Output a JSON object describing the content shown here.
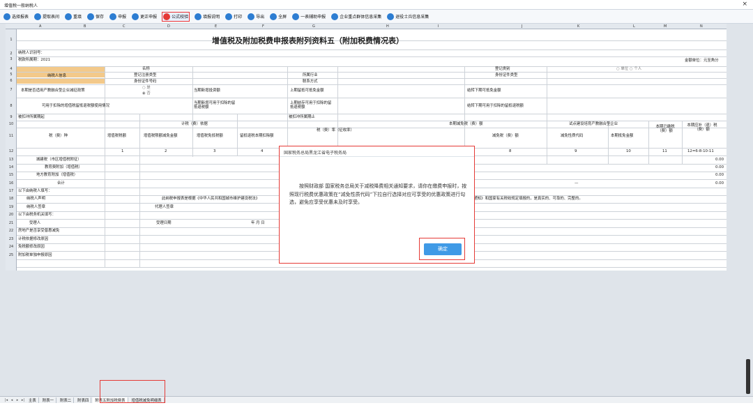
{
  "window": {
    "title": "增值税一般纳税人",
    "close": "×"
  },
  "toolbar": [
    {
      "icon": "list-icon",
      "label": "选择报表",
      "color": "#2d7dd2"
    },
    {
      "icon": "share-icon",
      "label": "提取表间",
      "color": "#2d7dd2"
    },
    {
      "icon": "close-circle-icon",
      "label": "重填",
      "color": "#2d7dd2"
    },
    {
      "icon": "save-icon",
      "label": "保存",
      "color": "#2d7dd2"
    },
    {
      "icon": "cloud-upload-icon",
      "label": "申报",
      "color": "#2d7dd2"
    },
    {
      "icon": "cloud-refresh-icon",
      "label": "更正申报",
      "color": "#2d7dd2"
    },
    {
      "icon": "formula-icon",
      "label": "公式校验",
      "color": "#e53935"
    },
    {
      "icon": "help-icon",
      "label": "填报说明",
      "color": "#2d7dd2"
    },
    {
      "icon": "print-icon",
      "label": "打印",
      "color": "#2d7dd2"
    },
    {
      "icon": "export-icon",
      "label": "导出",
      "color": "#2d7dd2"
    },
    {
      "icon": "fullscreen-icon",
      "label": "全屏",
      "color": "#2d7dd2"
    },
    {
      "icon": "resize-icon",
      "label": "一表辅助申报",
      "color": "#2d7dd2"
    },
    {
      "icon": "cloud-collect-icon",
      "label": "企业重点群体信息采集",
      "color": "#2d7dd2"
    },
    {
      "icon": "cloud-collect-icon",
      "label": "退役士兵信息采集",
      "color": "#2d7dd2"
    }
  ],
  "columns": [
    "A",
    "B",
    "C",
    "D",
    "E",
    "F",
    "G",
    "H",
    "I",
    "J",
    "K",
    "L",
    "M",
    "N"
  ],
  "rownums": [
    "1",
    "2",
    "3",
    "4",
    "5",
    "6",
    "7",
    "8",
    "9",
    "10",
    "11",
    "12",
    "13",
    "14",
    "15",
    "16",
    "17",
    "18",
    "19",
    "20",
    "21",
    "22",
    "23",
    "24",
    "25"
  ],
  "sheet": {
    "title": "增值税及附加税费申报表附列资料五（附加税费情况表）",
    "taxpayer_id": "纳税人识别号：",
    "period": "税款所属期：2021",
    "unit": "金额单位：元至角分",
    "r4_name": "名称",
    "r4_regtype": "登记类别",
    "r4_radio": "○ 单位 ○ 个人",
    "r5_info": "纳税人信息",
    "r5_reg": "登记注册类型",
    "r5_industry": "所属行业",
    "r5_idtype": "身份证件类型",
    "r6_idno": "身份证件号码",
    "r6_contact": "联系方式",
    "r7_q": "本期是否适用产教融合型企业减征政策",
    "r7_yes": "○ 是",
    "r7_no": "◉ 否",
    "r7_invest": "当期新增投资额",
    "r7_lastcredit": "上期留抵可抵免金额",
    "r7_nextcredit": "结转下期可抵免金额",
    "r8_usage": "可用于扣除的增值税留抵退税额使用情况",
    "r8_newcredit": "当期新增可用于扣除的留抵退税额",
    "r8_lastremain": "上期结存可用于扣除的留抵退税额",
    "r8_nextremain": "结转下期可用于扣除的留抵退税额",
    "r9_start": "被扣冲所属期起",
    "r9_end": "被扣冲所属期止",
    "r10_basis": "计税（费）依据",
    "r10_reduce": "本期减免税（费）额",
    "r10_pilot": "试点建设培育产教融合型企业",
    "r10_paid": "本期已缴税（费）额",
    "r10_refund": "本期应补（退）税（费）额",
    "r10_type": "税（费）种",
    "r11_vat": "增值税税额",
    "r11_vatdeduct": "增值税限额减免金额",
    "r11_exempt": "增值税免抵税额",
    "r11_retain": "留抵退税本期扣除额",
    "r11_rate": "税（费）率（征收率）",
    "r11_reducecode": "减免性质代码",
    "r11_reduceamt": "减免税（费）额",
    "r11_pilotcode": "减免性质代码",
    "r11_pilotamt": "本期抵免金额",
    "r12_c1": "1",
    "r12_c2": "2",
    "r12_c3": "3",
    "r12_c4": "4",
    "r12_c8": "8",
    "r12_c9": "9",
    "r12_c10": "10",
    "r12_c11": "11",
    "r12_c12": "12=6-8-10-11",
    "r13": "城建税（市区增值税附征）",
    "r14": "教育费附加（增值税）",
    "r15": "地方教育附加（增值税）",
    "r16": "合计",
    "r16_dash": "—",
    "amt": "0.00",
    "r17": "以下由纳税人填写：",
    "r18_label": "纳税人声明",
    "r18_text": "此纳税申报表是根据《中华人民共和国城市维护建设税法》",
    "r18_tail": "的通知》和国家有关税收规定填报的，是真实的、可靠的、完整的。",
    "r19_label": "纳税人签章",
    "r19_agent": "代理人签章",
    "r20": "以下由税务机关填写：",
    "r21_label": "受理人",
    "r21_date": "受理日期",
    "r21_ymd": "年  月  日",
    "r22": "房地产是否享受普惠减免",
    "r23": "计税依据修改原因",
    "r24": "免税额修改原因",
    "r25": "附加税单独申报原因"
  },
  "tabs": [
    "主表",
    "附表一",
    "附表二",
    "附表四",
    "附表五附加税费表",
    "增值税减免明细表"
  ],
  "dialog": {
    "title": "国家税务总局黑龙江省电子税务局",
    "body": "按照财政部 国家税务总局关于减税降费相关通知要求，请你在缴费申报时，按照现行税费优惠政策在“减免性质代码”下拉自行选择对应可享受的优惠政策进行勾选，避免应享受优惠未及时享受。",
    "ok": "确定"
  }
}
